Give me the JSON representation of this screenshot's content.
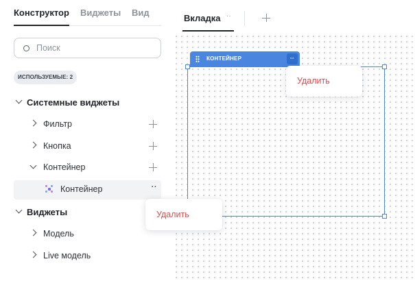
{
  "panel_tabs": [
    "Конструктор",
    "Виджеты",
    "Вид"
  ],
  "search": {
    "placeholder": "Поиск"
  },
  "used_badge": "ИСПОЛЬЗУЕМЫЕ: 2",
  "tree": {
    "system_group": "Системные виджеты",
    "filter": "Фильтр",
    "button": "Кнопка",
    "container": "Контейнер",
    "container_child": "Контейнер",
    "widgets_group": "Виджеты",
    "model": "Модель",
    "live_model": "Live модель"
  },
  "context_menu_left": {
    "delete": "Удалить"
  },
  "canvas": {
    "tab_label": "Вкладка",
    "tab_menu": "··",
    "container_header": "КОНТЕЙНЕР",
    "container_menu": "··",
    "context_menu": {
      "delete": "Удалить"
    }
  },
  "colors": {
    "accent": "#4a86e0",
    "danger": "#e5484d",
    "selected_row": "#f2f3f5"
  },
  "icons": [
    "search-icon",
    "chevron-down-icon",
    "chevron-right-icon",
    "plus-icon",
    "more-dots-icon",
    "container-widget-icon",
    "drag-handle-icon"
  ]
}
